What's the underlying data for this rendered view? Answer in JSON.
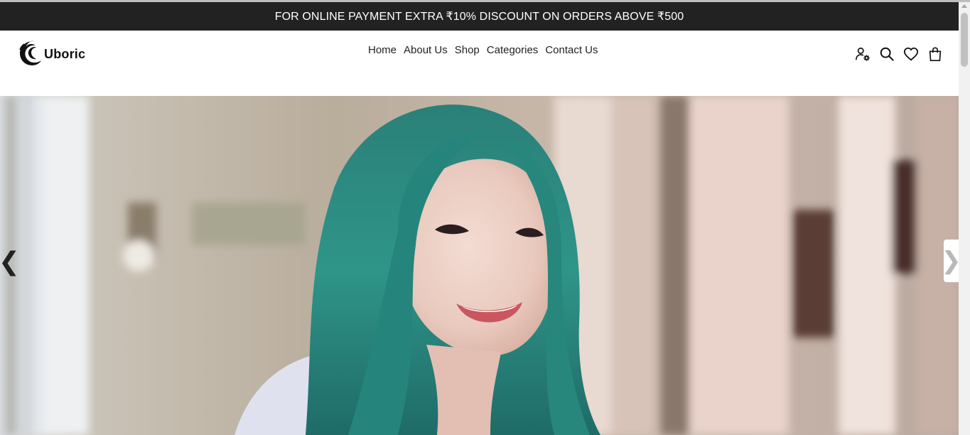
{
  "announcement": {
    "text": "FOR ONLINE PAYMENT EXTRA ₹10% DISCOUNT ON ORDERS ABOVE ₹500"
  },
  "brand": {
    "name": "Uboric",
    "logo_icon": "wave-swirl-icon"
  },
  "nav": {
    "items": [
      {
        "label": "Home"
      },
      {
        "label": "About Us"
      },
      {
        "label": "Shop"
      },
      {
        "label": "Categories"
      },
      {
        "label": "Contact Us"
      }
    ]
  },
  "header_icons": [
    "account-settings-icon",
    "search-icon",
    "heart-icon",
    "shopping-bag-icon"
  ],
  "slider": {
    "prev_label": "❮",
    "next_label": "❯",
    "image": "smiling woman with teal hair"
  },
  "colors": {
    "announcement_bg": "#222222",
    "text": "#222222",
    "accent_hair": "#2f8f86"
  }
}
